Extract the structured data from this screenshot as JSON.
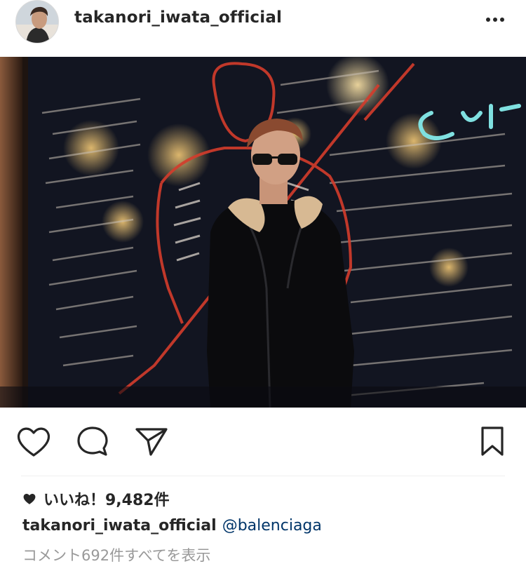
{
  "header": {
    "username": "takanori_iwata_official"
  },
  "post": {
    "image_alt": "Man in sunglasses and leather jacket in front of a window painted with a skeleton figure and text"
  },
  "actions": {
    "like_icon": "heart-outline-icon",
    "comment_icon": "comment-bubble-icon",
    "share_icon": "paper-plane-icon",
    "save_icon": "bookmark-icon"
  },
  "likes": {
    "text": "いいね！9,482件"
  },
  "caption": {
    "username": "takanori_iwata_official",
    "mention": "@balenciaga"
  },
  "comments": {
    "view_all": "コメント692件すべてを表示"
  }
}
